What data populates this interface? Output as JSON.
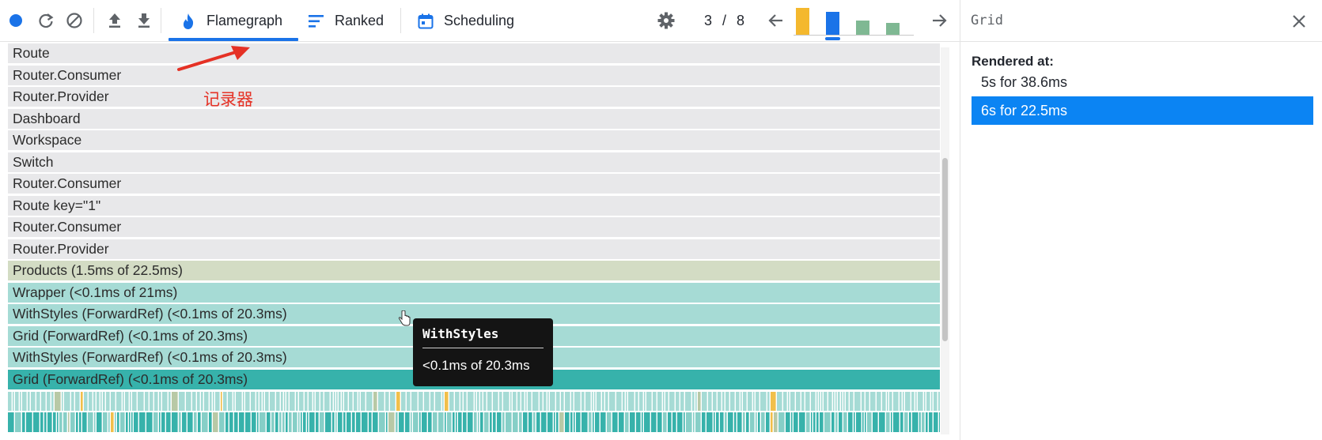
{
  "toolbar": {
    "icons": [
      "record-icon",
      "reload-icon",
      "clear-icon",
      "upload-icon",
      "download-icon",
      "gear-icon"
    ],
    "tabs": [
      {
        "label": "Flamegraph",
        "icon": "flame-icon",
        "active": true
      },
      {
        "label": "Ranked",
        "icon": "ranked-icon",
        "active": false
      },
      {
        "label": "Scheduling",
        "icon": "calendar-icon",
        "active": false
      }
    ],
    "commit_current": "3",
    "commit_separator": "/",
    "commit_total": "8",
    "commit_bars": [
      {
        "level": 0.85,
        "color": "#f4b82e",
        "selected": false
      },
      {
        "level": 0.72,
        "color": "#1a73e8",
        "selected": true
      },
      {
        "level": 0.45,
        "color": "#7fb893",
        "selected": false
      },
      {
        "level": 0.38,
        "color": "#7fb893",
        "selected": false
      }
    ]
  },
  "annotation": {
    "text": "记录器",
    "color": "#e53125"
  },
  "flame_rows": [
    {
      "label": "Route",
      "style": "gray"
    },
    {
      "label": "Router.Consumer",
      "style": "gray"
    },
    {
      "label": "Router.Provider",
      "style": "gray"
    },
    {
      "label": "Dashboard",
      "style": "gray"
    },
    {
      "label": "Workspace",
      "style": "gray"
    },
    {
      "label": "Switch",
      "style": "gray"
    },
    {
      "label": "Router.Consumer",
      "style": "gray"
    },
    {
      "label": "Route key=\"1\"",
      "style": "gray"
    },
    {
      "label": "Router.Consumer",
      "style": "gray"
    },
    {
      "label": "Router.Provider",
      "style": "gray"
    },
    {
      "label": "Products (1.5ms of 22.5ms)",
      "style": "olive"
    },
    {
      "label": "Wrapper (<0.1ms of 21ms)",
      "style": "teal"
    },
    {
      "label": "WithStyles (ForwardRef) (<0.1ms of 20.3ms)",
      "style": "teal"
    },
    {
      "label": "Grid (ForwardRef) (<0.1ms of 20.3ms)",
      "style": "teal"
    },
    {
      "label": "WithStyles (ForwardRef) (<0.1ms of 20.3ms)",
      "style": "teal"
    },
    {
      "label": "Grid (ForwardRef) (<0.1ms of 20.3ms)",
      "style": "teal-dark"
    }
  ],
  "tooltip": {
    "title": "WithStyles",
    "value": "<0.1ms of 20.3ms"
  },
  "sidebar": {
    "title": "Grid",
    "rendered_at_label": "Rendered at:",
    "commits": [
      {
        "label": "5s for 38.6ms",
        "selected": false
      },
      {
        "label": "6s for 22.5ms",
        "selected": true
      }
    ]
  },
  "colors": {
    "accent": "#1a73e8",
    "selection": "#0b84f3",
    "teal": "#a6dbd5",
    "teal_dark": "#37b2ab",
    "olive": "#d3dcc4",
    "gray_row": "#e8e8ea"
  }
}
